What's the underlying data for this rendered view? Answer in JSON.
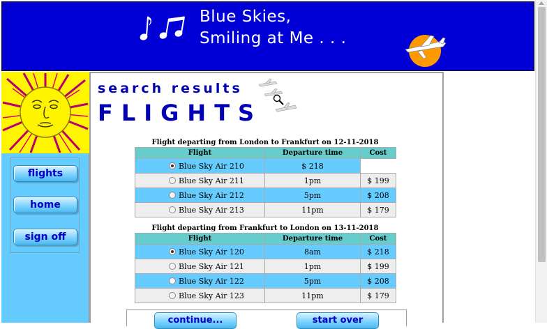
{
  "header": {
    "title_line1": "Blue Skies,",
    "title_line2": "Smiling at Me . . ."
  },
  "content": {
    "heading_search": "search results",
    "heading_flights": "FLIGHTS"
  },
  "nav": {
    "items": [
      {
        "label": "flights"
      },
      {
        "label": "home"
      },
      {
        "label": "sign off"
      }
    ]
  },
  "outbound": {
    "caption": "Flight departing from London to Frankfurt on 12-11-2018",
    "headers": [
      "Flight",
      "Departure time",
      "Cost"
    ],
    "rows": [
      {
        "flight": "Blue Sky Air 210",
        "time": "$ 218",
        "cost": "",
        "selected": true
      },
      {
        "flight": "Blue Sky Air 211",
        "time": "1pm",
        "cost": "$ 199",
        "selected": false
      },
      {
        "flight": "Blue Sky Air 212",
        "time": "5pm",
        "cost": "$ 208",
        "selected": false
      },
      {
        "flight": "Blue Sky Air 213",
        "time": "11pm",
        "cost": "$ 179",
        "selected": false
      }
    ]
  },
  "return": {
    "caption": "Flight departing from Frankfurt to London on 13-11-2018",
    "headers": [
      "Flight",
      "Departure time",
      "Cost"
    ],
    "rows": [
      {
        "flight": "Blue Sky Air 120",
        "time": "8am",
        "cost": "$ 218",
        "selected": true
      },
      {
        "flight": "Blue Sky Air 121",
        "time": "1pm",
        "cost": "$ 199",
        "selected": false
      },
      {
        "flight": "Blue Sky Air 122",
        "time": "5pm",
        "cost": "$ 208",
        "selected": false
      },
      {
        "flight": "Blue Sky Air 123",
        "time": "11pm",
        "cost": "$ 179",
        "selected": false
      }
    ]
  },
  "actions": {
    "continue_label": "continue...",
    "start_over_label": "start over"
  },
  "colors": {
    "header_bg": "#0000d6",
    "sidebar_bg": "#66ccff",
    "row_highlight": "#66ccff",
    "table_header": "#66cccc",
    "heading": "#0000b4"
  }
}
